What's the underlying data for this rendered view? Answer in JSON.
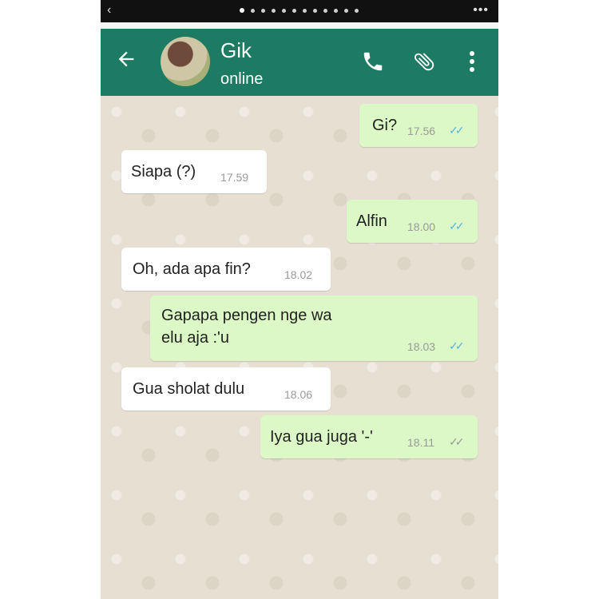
{
  "contact": {
    "name": "Gik",
    "status": "online"
  },
  "messages": [
    {
      "direction": "out",
      "text": "Gi?",
      "time": "17.56",
      "read": true
    },
    {
      "direction": "in",
      "text": "Siapa (?)",
      "time": "17.59"
    },
    {
      "direction": "out",
      "text": "Alfin",
      "time": "18.00",
      "read": true
    },
    {
      "direction": "in",
      "text": "Oh, ada apa fin?",
      "time": "18.02"
    },
    {
      "direction": "out",
      "text_line1": "Gapapa pengen nge wa",
      "text_line2": "elu aja :'u",
      "time": "18.03",
      "read": true
    },
    {
      "direction": "in",
      "text": "Gua sholat dulu",
      "time": "18.06"
    },
    {
      "direction": "out",
      "text": "Iya gua juga '-'",
      "time": "18.11",
      "read": false
    }
  ],
  "icons": {
    "back": "arrow-left-icon",
    "call": "phone-icon",
    "attach": "paperclip-icon",
    "menu": "more-vertical-icon"
  },
  "colors": {
    "header": "#1e7b63",
    "outgoing": "#dcf8c6",
    "incoming": "#ffffff",
    "read_tick": "#5ab3e0"
  }
}
